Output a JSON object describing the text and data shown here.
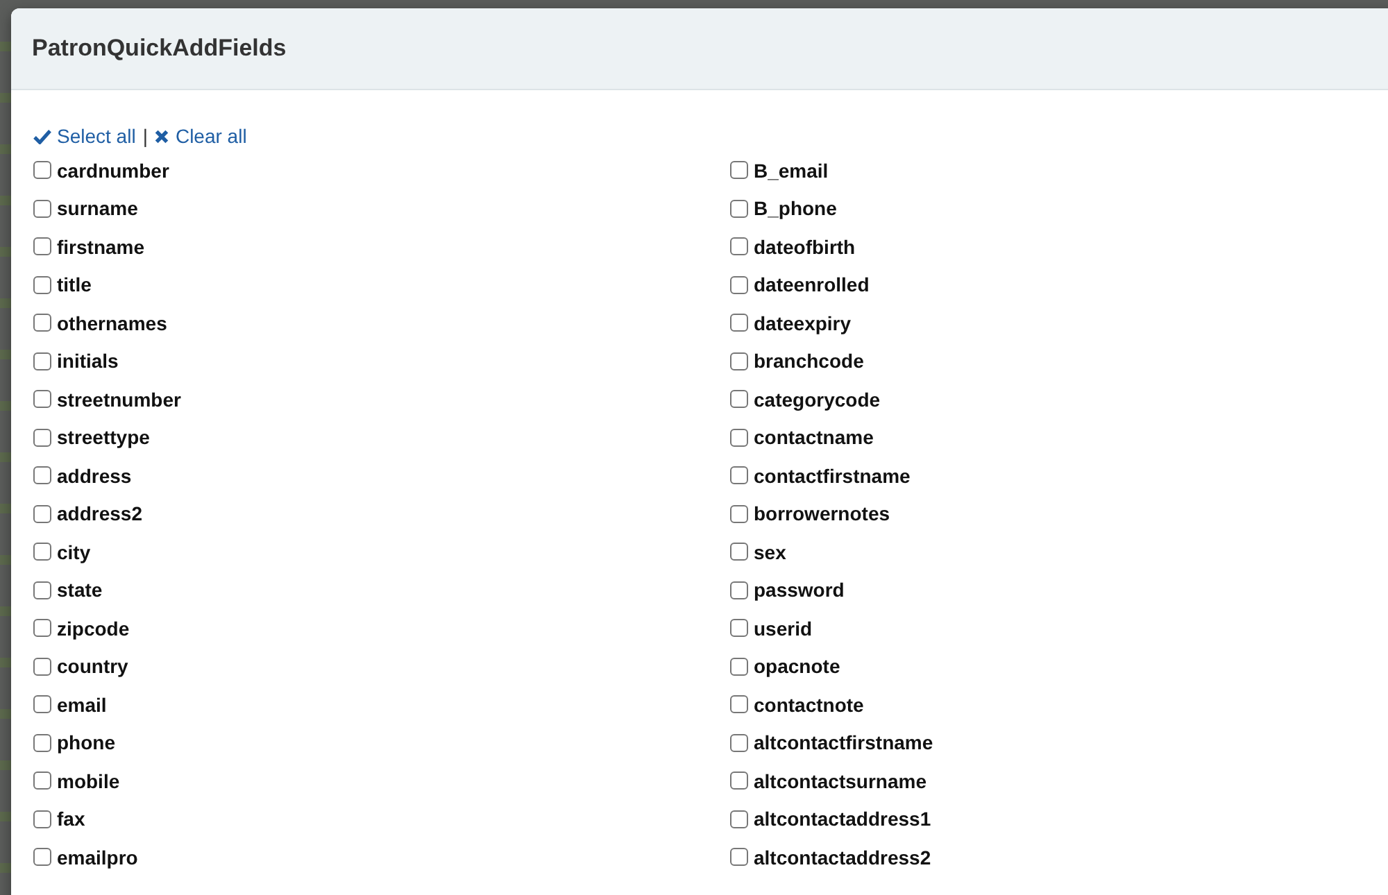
{
  "modal": {
    "title": "PatronQuickAddFields",
    "select_all": "Select all",
    "separator": "|",
    "clear_all": "Clear all",
    "columns": [
      [
        {
          "label": "cardnumber",
          "checked": false
        },
        {
          "label": "surname",
          "checked": false
        },
        {
          "label": "firstname",
          "checked": false
        },
        {
          "label": "title",
          "checked": false
        },
        {
          "label": "othernames",
          "checked": false
        },
        {
          "label": "initials",
          "checked": false
        },
        {
          "label": "streetnumber",
          "checked": false
        },
        {
          "label": "streettype",
          "checked": false
        },
        {
          "label": "address",
          "checked": false
        },
        {
          "label": "address2",
          "checked": false
        },
        {
          "label": "city",
          "checked": false
        },
        {
          "label": "state",
          "checked": false
        },
        {
          "label": "zipcode",
          "checked": false
        },
        {
          "label": "country",
          "checked": false
        },
        {
          "label": "email",
          "checked": false
        },
        {
          "label": "phone",
          "checked": false
        },
        {
          "label": "mobile",
          "checked": false
        },
        {
          "label": "fax",
          "checked": false
        },
        {
          "label": "emailpro",
          "checked": false
        }
      ],
      [
        {
          "label": "B_email",
          "checked": false
        },
        {
          "label": "B_phone",
          "checked": false
        },
        {
          "label": "dateofbirth",
          "checked": false
        },
        {
          "label": "dateenrolled",
          "checked": false
        },
        {
          "label": "dateexpiry",
          "checked": false
        },
        {
          "label": "branchcode",
          "checked": false
        },
        {
          "label": "categorycode",
          "checked": false
        },
        {
          "label": "contactname",
          "checked": false
        },
        {
          "label": "contactfirstname",
          "checked": false
        },
        {
          "label": "borrowernotes",
          "checked": false
        },
        {
          "label": "sex",
          "checked": false
        },
        {
          "label": "password",
          "checked": false
        },
        {
          "label": "userid",
          "checked": false
        },
        {
          "label": "opacnote",
          "checked": false
        },
        {
          "label": "contactnote",
          "checked": false
        },
        {
          "label": "altcontactfirstname",
          "checked": false
        },
        {
          "label": "altcontactsurname",
          "checked": false
        },
        {
          "label": "altcontactaddress1",
          "checked": false
        },
        {
          "label": "altcontactaddress2",
          "checked": false
        }
      ]
    ]
  }
}
